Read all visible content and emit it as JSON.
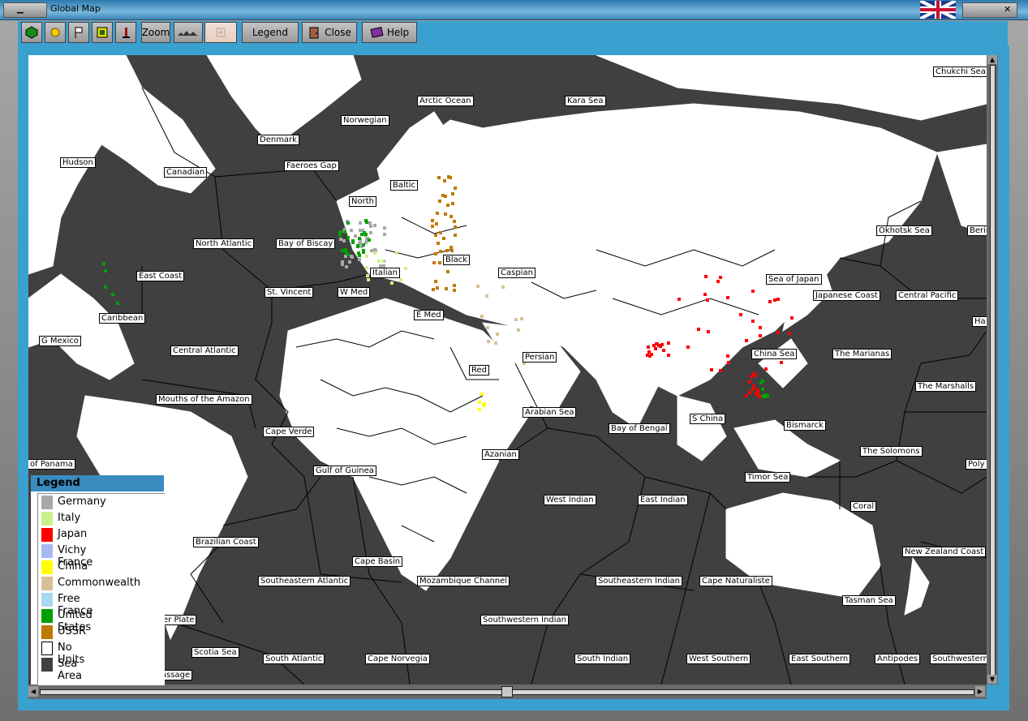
{
  "window": {
    "title": "Global Map"
  },
  "toolbar": {
    "zoom_label": "Zoom",
    "legend_label": "Legend",
    "close_label": "Close",
    "help_label": "Help"
  },
  "legend": {
    "title": "Legend",
    "items": [
      {
        "label": "Germany",
        "color": "#a8a8a8"
      },
      {
        "label": "Italy",
        "color": "#ccf088"
      },
      {
        "label": "Japan",
        "color": "#ff0000"
      },
      {
        "label": "Vichy France",
        "color": "#a8b8f0"
      },
      {
        "label": "China",
        "color": "#ffff00"
      },
      {
        "label": "Commonwealth",
        "color": "#d8c098"
      },
      {
        "label": "Free France",
        "color": "#a8d8f0"
      },
      {
        "label": "United States",
        "color": "#00a000"
      },
      {
        "label": "USSR",
        "color": "#c07800"
      },
      {
        "label": "No Units",
        "color": "#ffffff"
      },
      {
        "label": "Sea Area",
        "color": "#404040"
      }
    ]
  },
  "sea_labels": [
    "Arctic Ocean",
    "Kara Sea",
    "Chukchi Sea",
    "Norwegian",
    "Denmark",
    "Hudson",
    "Faeroes Gap",
    "Canadian",
    "Baltic",
    "North",
    "North Atlantic",
    "Bay of Biscay",
    "Okhotsk Sea",
    "Bering",
    "Black",
    "Caspian",
    "East Coast",
    "Italian",
    "Sea of Japan",
    "St. Vincent",
    "W Med",
    "Japanese Coast",
    "Central Pacific",
    "Caribbean",
    "E Med",
    "G Mexico",
    "Central Atlantic",
    "Persian",
    "China Sea",
    "The Marianas",
    "Red",
    "The Marshalls",
    "Mouths of the Amazon",
    "Arabian Sea",
    "S China",
    "Bay of Bengal",
    "Bismarck",
    "Cape Verde",
    "Azanian",
    "The Solomons",
    "of Panama",
    "Gulf of Guinea",
    "Timor Sea",
    "West Indian",
    "East Indian",
    "Coral",
    "Brazilian Coast",
    "Cape Basin",
    "New Zealand Coast",
    "Southeastern Atlantic",
    "Mozambique Channel",
    "Southeastern Indian",
    "Cape Naturaliste",
    "Tasman Sea",
    "Southwestern Indian",
    "er Plate",
    "Scotia Sea",
    "South Atlantic",
    "Cape Norvegia",
    "South Indian",
    "West Southern",
    "East Southern",
    "Antipodes",
    "Southwestern",
    "assage",
    "Ha",
    "Poly"
  ]
}
